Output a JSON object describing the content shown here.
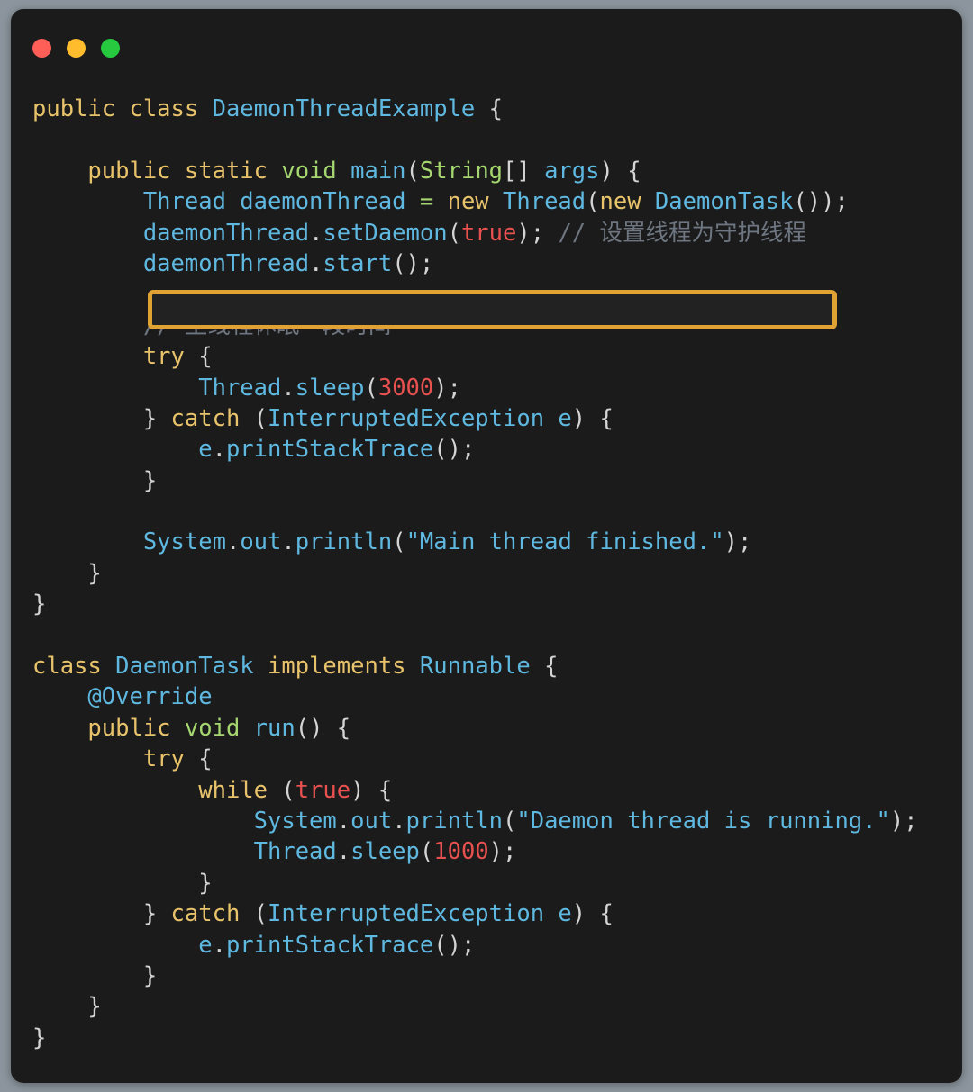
{
  "window": {
    "traffic_lights": [
      {
        "name": "close-dot",
        "color": "#ff5f56"
      },
      {
        "name": "minimize-dot",
        "color": "#ffbd2e"
      },
      {
        "name": "maximize-dot",
        "color": "#27c93f"
      }
    ],
    "background": "#1b1b1b",
    "page_background": "#8c959d"
  },
  "highlight": {
    "border_color": "#dfa233",
    "target_line_index": 3
  },
  "theme": {
    "keyword": "#e8c36b",
    "type": "#a5d66f",
    "identifier": "#5fb8e0",
    "number": "#e8514f",
    "comment": "#6e7681",
    "punctuation": "#d4d4d4"
  },
  "code": {
    "language": "java",
    "lines": [
      "public class DaemonThreadExample {",
      "",
      "    public static void main(String[] args) {",
      "        Thread daemonThread = new Thread(new DaemonTask());",
      "        daemonThread.setDaemon(true); // 设置线程为守护线程",
      "        daemonThread.start();",
      "",
      "        // 主线程休眠一段时间",
      "        try {",
      "            Thread.sleep(3000);",
      "        } catch (InterruptedException e) {",
      "            e.printStackTrace();",
      "        }",
      "",
      "        System.out.println(\"Main thread finished.\");",
      "    }",
      "}",
      "",
      "class DaemonTask implements Runnable {",
      "    @Override",
      "    public void run() {",
      "        try {",
      "            while (true) {",
      "                System.out.println(\"Daemon thread is running.\");",
      "                Thread.sleep(1000);",
      "            }",
      "        } catch (InterruptedException e) {",
      "            e.printStackTrace();",
      "        }",
      "    }",
      "}"
    ],
    "tokens": [
      [
        [
          "public ",
          "kw"
        ],
        [
          "class ",
          "kw"
        ],
        [
          "DaemonThreadExample",
          "id"
        ],
        [
          " {",
          "pun"
        ]
      ],
      [],
      [
        [
          "    ",
          "pun"
        ],
        [
          "public ",
          "kw"
        ],
        [
          "static ",
          "kw"
        ],
        [
          "void ",
          "typ"
        ],
        [
          "main",
          "id"
        ],
        [
          "(",
          "pun"
        ],
        [
          "String",
          "typ"
        ],
        [
          "[] ",
          "pun"
        ],
        [
          "args",
          "id"
        ],
        [
          ") {",
          "pun"
        ]
      ],
      [
        [
          "        ",
          "pun"
        ],
        [
          "Thread daemonThread ",
          "id"
        ],
        [
          "=",
          "typ"
        ],
        [
          " ",
          "pun"
        ],
        [
          "new ",
          "kw"
        ],
        [
          "Thread",
          "id"
        ],
        [
          "(",
          "pun"
        ],
        [
          "new ",
          "kw"
        ],
        [
          "DaemonTask",
          "id"
        ],
        [
          "());",
          "pun"
        ]
      ],
      [
        [
          "        ",
          "pun"
        ],
        [
          "daemonThread",
          "id"
        ],
        [
          ".",
          "pun"
        ],
        [
          "setDaemon",
          "id"
        ],
        [
          "(",
          "pun"
        ],
        [
          "true",
          "num"
        ],
        [
          "); ",
          "pun"
        ],
        [
          "// 设置线程为守护线程",
          "cmt"
        ]
      ],
      [
        [
          "        ",
          "pun"
        ],
        [
          "daemonThread",
          "id"
        ],
        [
          ".",
          "pun"
        ],
        [
          "start",
          "id"
        ],
        [
          "();",
          "pun"
        ]
      ],
      [],
      [
        [
          "        ",
          "pun"
        ],
        [
          "// 主线程休眠一段时间",
          "cmt"
        ]
      ],
      [
        [
          "        ",
          "pun"
        ],
        [
          "try",
          "kw"
        ],
        [
          " {",
          "pun"
        ]
      ],
      [
        [
          "            ",
          "pun"
        ],
        [
          "Thread",
          "id"
        ],
        [
          ".",
          "pun"
        ],
        [
          "sleep",
          "id"
        ],
        [
          "(",
          "pun"
        ],
        [
          "3000",
          "num"
        ],
        [
          ");",
          "pun"
        ]
      ],
      [
        [
          "        } ",
          "pun"
        ],
        [
          "catch",
          "kw"
        ],
        [
          " (",
          "pun"
        ],
        [
          "InterruptedException e",
          "id"
        ],
        [
          ") {",
          "pun"
        ]
      ],
      [
        [
          "            ",
          "pun"
        ],
        [
          "e",
          "id"
        ],
        [
          ".",
          "pun"
        ],
        [
          "printStackTrace",
          "id"
        ],
        [
          "();",
          "pun"
        ]
      ],
      [
        [
          "        }",
          "pun"
        ]
      ],
      [],
      [
        [
          "        ",
          "pun"
        ],
        [
          "System",
          "id"
        ],
        [
          ".",
          "pun"
        ],
        [
          "out",
          "id"
        ],
        [
          ".",
          "pun"
        ],
        [
          "println",
          "id"
        ],
        [
          "(",
          "pun"
        ],
        [
          "\"Main thread finished.\"",
          "id"
        ],
        [
          ");",
          "pun"
        ]
      ],
      [
        [
          "    }",
          "pun"
        ]
      ],
      [
        [
          "}",
          "pun"
        ]
      ],
      [],
      [
        [
          "class ",
          "kw"
        ],
        [
          "DaemonTask ",
          "id"
        ],
        [
          "implements ",
          "kw"
        ],
        [
          "Runnable",
          "id"
        ],
        [
          " {",
          "pun"
        ]
      ],
      [
        [
          "    ",
          "pun"
        ],
        [
          "@Override",
          "id"
        ]
      ],
      [
        [
          "    ",
          "pun"
        ],
        [
          "public ",
          "kw"
        ],
        [
          "void ",
          "typ"
        ],
        [
          "run",
          "id"
        ],
        [
          "() {",
          "pun"
        ]
      ],
      [
        [
          "        ",
          "pun"
        ],
        [
          "try",
          "kw"
        ],
        [
          " {",
          "pun"
        ]
      ],
      [
        [
          "            ",
          "pun"
        ],
        [
          "while",
          "kw"
        ],
        [
          " (",
          "pun"
        ],
        [
          "true",
          "num"
        ],
        [
          ") {",
          "pun"
        ]
      ],
      [
        [
          "                ",
          "pun"
        ],
        [
          "System",
          "id"
        ],
        [
          ".",
          "pun"
        ],
        [
          "out",
          "id"
        ],
        [
          ".",
          "pun"
        ],
        [
          "println",
          "id"
        ],
        [
          "(",
          "pun"
        ],
        [
          "\"Daemon thread is running.\"",
          "id"
        ],
        [
          ");",
          "pun"
        ]
      ],
      [
        [
          "                ",
          "pun"
        ],
        [
          "Thread",
          "id"
        ],
        [
          ".",
          "pun"
        ],
        [
          "sleep",
          "id"
        ],
        [
          "(",
          "pun"
        ],
        [
          "1000",
          "num"
        ],
        [
          ");",
          "pun"
        ]
      ],
      [
        [
          "            }",
          "pun"
        ]
      ],
      [
        [
          "        } ",
          "pun"
        ],
        [
          "catch",
          "kw"
        ],
        [
          " (",
          "pun"
        ],
        [
          "InterruptedException e",
          "id"
        ],
        [
          ") {",
          "pun"
        ]
      ],
      [
        [
          "            ",
          "pun"
        ],
        [
          "e",
          "id"
        ],
        [
          ".",
          "pun"
        ],
        [
          "printStackTrace",
          "id"
        ],
        [
          "();",
          "pun"
        ]
      ],
      [
        [
          "        }",
          "pun"
        ]
      ],
      [
        [
          "    }",
          "pun"
        ]
      ],
      [
        [
          "}",
          "pun"
        ]
      ]
    ]
  }
}
